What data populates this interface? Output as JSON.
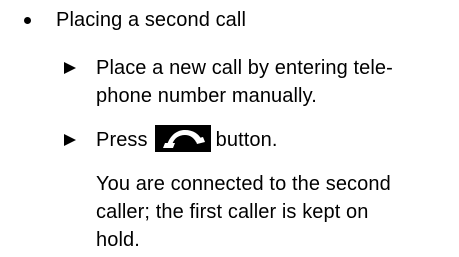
{
  "bullet_heading": "Placing a second call",
  "step1": {
    "line1": "Place a new call by entering tele-",
    "line2": "phone number manually."
  },
  "step2": {
    "before_icon": "Press",
    "icon": "phone-handset-icon",
    "after_icon": "button."
  },
  "result": {
    "line1": "You are connected to the second",
    "line2": "caller; the first caller is kept on",
    "line3": "hold."
  }
}
